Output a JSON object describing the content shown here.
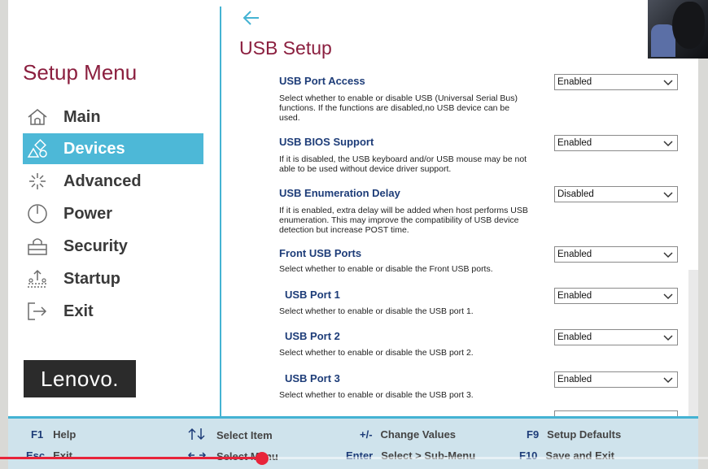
{
  "sidebar": {
    "title": "Setup Menu",
    "items": [
      {
        "label": "Main",
        "icon": "home-icon"
      },
      {
        "label": "Devices",
        "icon": "devices-icon",
        "active": true
      },
      {
        "label": "Advanced",
        "icon": "advanced-icon"
      },
      {
        "label": "Power",
        "icon": "power-icon"
      },
      {
        "label": "Security",
        "icon": "lock-icon"
      },
      {
        "label": "Startup",
        "icon": "startup-icon"
      },
      {
        "label": "Exit",
        "icon": "exit-icon"
      }
    ],
    "logo": "Lenovo."
  },
  "main": {
    "title": "USB Setup",
    "settings": [
      {
        "label": "USB Port Access",
        "desc": "Select whether to enable or disable USB (Universal Serial Bus) functions. If the functions are disabled,no USB device can be used.",
        "value": "Enabled"
      },
      {
        "label": "USB BIOS Support",
        "desc": "If it is disabled, the USB keyboard and/or USB mouse may be not able to be used without device driver support.",
        "value": "Enabled"
      },
      {
        "label": "USB Enumeration Delay",
        "desc": "If it is enabled, extra delay will be added when host performs USB enumeration. This may improve the compatibility of USB device detection but increase POST time.",
        "value": "Disabled"
      },
      {
        "label": "Front USB Ports",
        "desc": "Select whether to enable or disable the Front USB ports.",
        "value": "Enabled"
      },
      {
        "label": "USB Port 1",
        "desc": "Select whether to enable or disable the USB port 1.",
        "value": "Enabled"
      },
      {
        "label": "USB Port 2",
        "desc": "Select whether to enable or disable the USB port 2.",
        "value": "Enabled"
      },
      {
        "label": "USB Port 3",
        "desc": "Select whether to enable or disable the USB port 3.",
        "value": "Enabled"
      }
    ]
  },
  "footer": {
    "f1_key": "F1",
    "f1_desc": "Help",
    "esc_key": "Esc",
    "esc_desc": "Exit",
    "updown_desc": "Select Item",
    "leftright_desc": "Select Menu",
    "pm_key": "+/-",
    "pm_desc": "Change Values",
    "enter_key": "Enter",
    "enter_desc": "Select > Sub-Menu",
    "f9_key": "F9",
    "f9_desc": "Setup Defaults",
    "f10_key": "F10",
    "f10_desc": "Save and Exit"
  },
  "video": {
    "progress_fraction": 0.37
  },
  "colors": {
    "accent": "#4db8d7",
    "title": "#8b1f3f",
    "label": "#1d3c78",
    "footer_bg": "#cfe3ec"
  }
}
